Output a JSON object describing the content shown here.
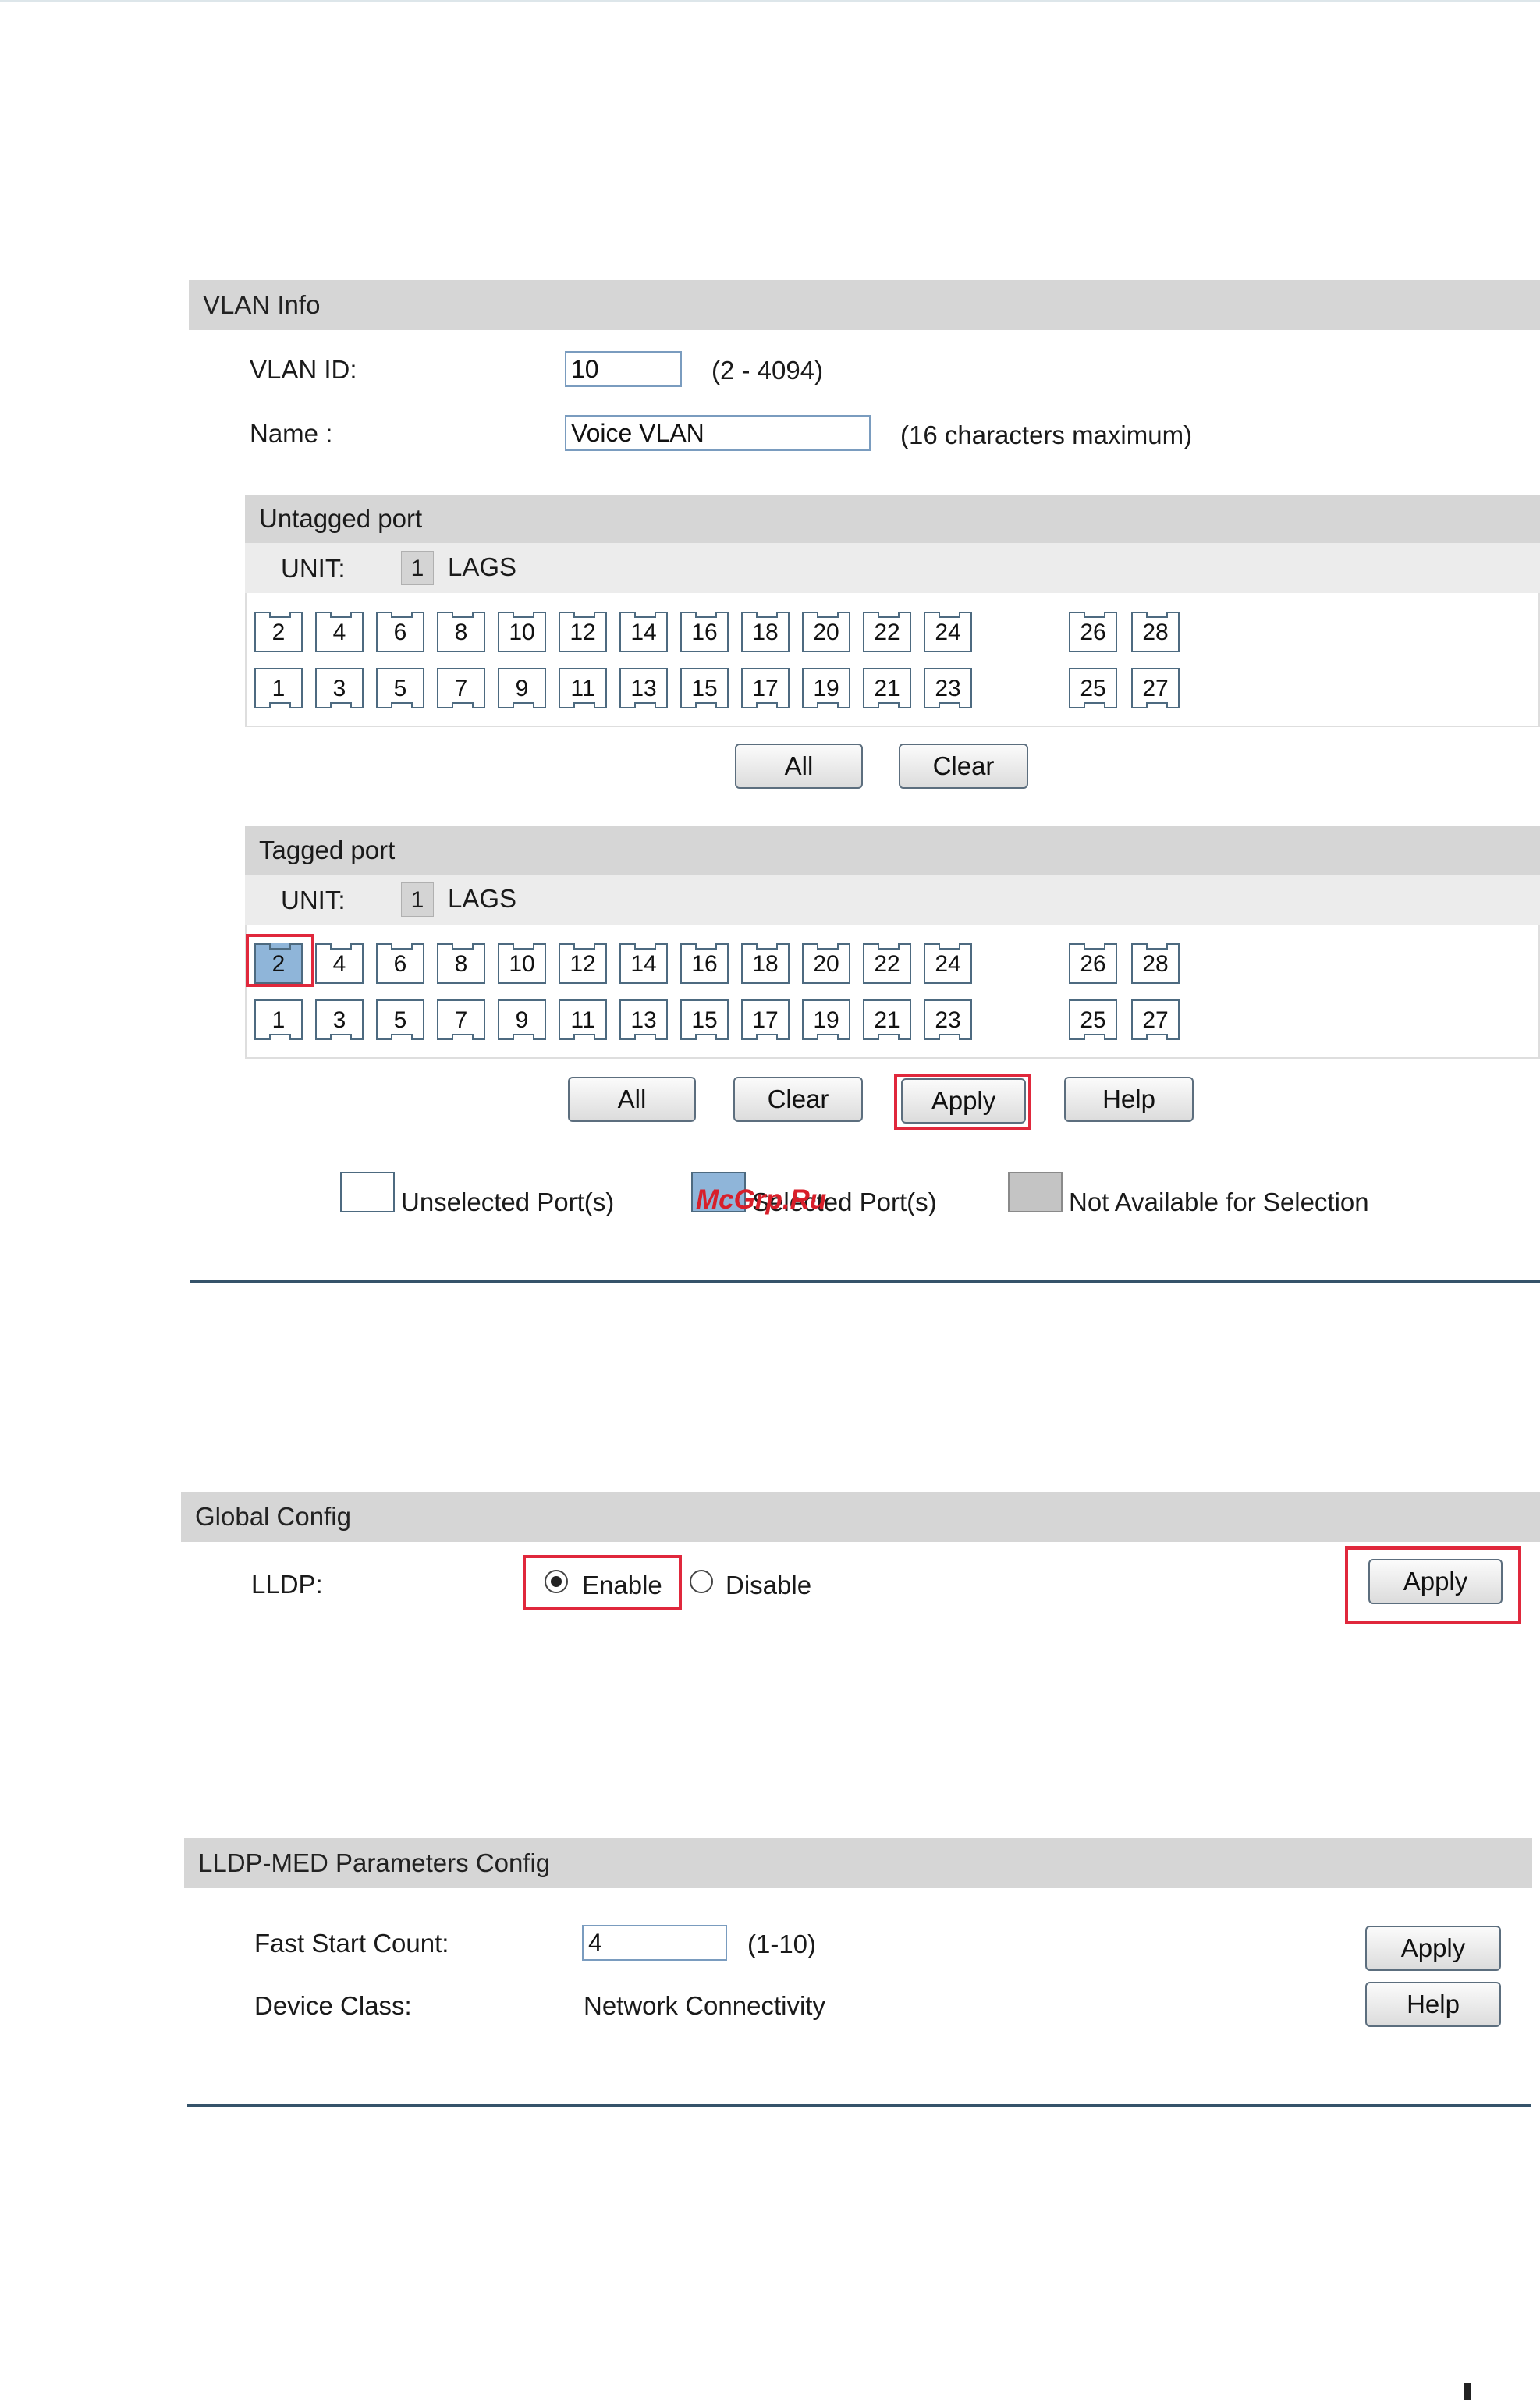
{
  "vlan_panel": {
    "title": "VLAN Info",
    "vlan_id_label": "VLAN ID:",
    "vlan_id_value": "10",
    "vlan_id_range": "(2 - 4094)",
    "name_label": "Name :",
    "name_value": "Voice VLAN",
    "name_hint": "(16 characters maximum)",
    "untagged": {
      "title": "Untagged port",
      "unit_label": "UNIT:",
      "unit_value": "1",
      "lags_label": "LAGS",
      "top_ports": [
        "2",
        "4",
        "6",
        "8",
        "10",
        "12",
        "14",
        "16",
        "18",
        "20",
        "22",
        "24"
      ],
      "top_extra": [
        "26",
        "28"
      ],
      "bottom_ports": [
        "1",
        "3",
        "5",
        "7",
        "9",
        "11",
        "13",
        "15",
        "17",
        "19",
        "21",
        "23"
      ],
      "bottom_extra": [
        "25",
        "27"
      ],
      "selected_ports": [],
      "all_label": "All",
      "clear_label": "Clear"
    },
    "tagged": {
      "title": "Tagged port",
      "unit_label": "UNIT:",
      "unit_value": "1",
      "lags_label": "LAGS",
      "top_ports": [
        "2",
        "4",
        "6",
        "8",
        "10",
        "12",
        "14",
        "16",
        "18",
        "20",
        "22",
        "24"
      ],
      "top_extra": [
        "26",
        "28"
      ],
      "bottom_ports": [
        "1",
        "3",
        "5",
        "7",
        "9",
        "11",
        "13",
        "15",
        "17",
        "19",
        "21",
        "23"
      ],
      "bottom_extra": [
        "25",
        "27"
      ],
      "selected_ports": [
        "2"
      ],
      "all_label": "All",
      "clear_label": "Clear",
      "apply_label": "Apply",
      "help_label": "Help"
    },
    "legend": {
      "unselected": "Unselected Port(s)",
      "selected": "Selected Port(s)",
      "unavailable": "Not Available for Selection"
    },
    "watermark": "McGrp.Ru"
  },
  "global_config": {
    "title": "Global Config",
    "lldp_label": "LLDP:",
    "enable_label": "Enable",
    "disable_label": "Disable",
    "selected": "Enable",
    "apply_label": "Apply"
  },
  "lldp_med": {
    "title": "LLDP-MED Parameters Config",
    "fast_start_label": "Fast Start Count:",
    "fast_start_value": "4",
    "fast_start_range": "(1-10)",
    "device_class_label": "Device Class:",
    "device_class_value": "Network Connectivity",
    "apply_label": "Apply",
    "help_label": "Help"
  },
  "colors": {
    "header_bg": "#d6d6d6",
    "selected_port": "#8fb5d9",
    "highlight_red": "#e0283c",
    "divider": "#35536a"
  }
}
